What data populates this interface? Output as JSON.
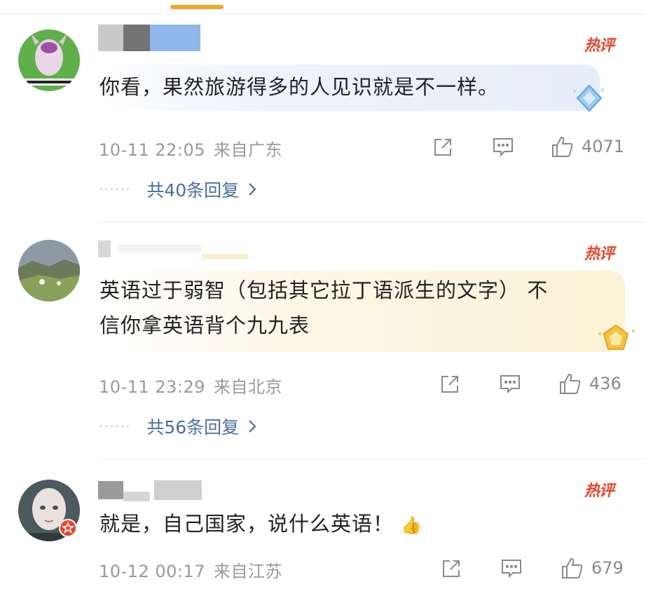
{
  "hot_label": "热评",
  "reply_icon": "share-icon",
  "comment_icon": "comment-icon",
  "like_icon": "thumbs-up-icon",
  "accent_color": "#e8462b",
  "comments": [
    {
      "text": "你看，果然旅游得多的人见识就是不一样。",
      "time": "10-11 22:05",
      "location": "来自广东",
      "likes": "4071",
      "replies": "共40条回复"
    },
    {
      "text_line1": "英语过于弱智（包括其它拉丁语派生的文字） 不",
      "text_line2": "信你拿英语背个九九表",
      "time": "10-11 23:29",
      "location": "来自北京",
      "likes": "436",
      "replies": "共56条回复"
    },
    {
      "text": "就是，自己国家，说什么英语！",
      "emoji": "👍",
      "time": "10-12 00:17",
      "location": "来自江苏",
      "likes": "679"
    }
  ]
}
